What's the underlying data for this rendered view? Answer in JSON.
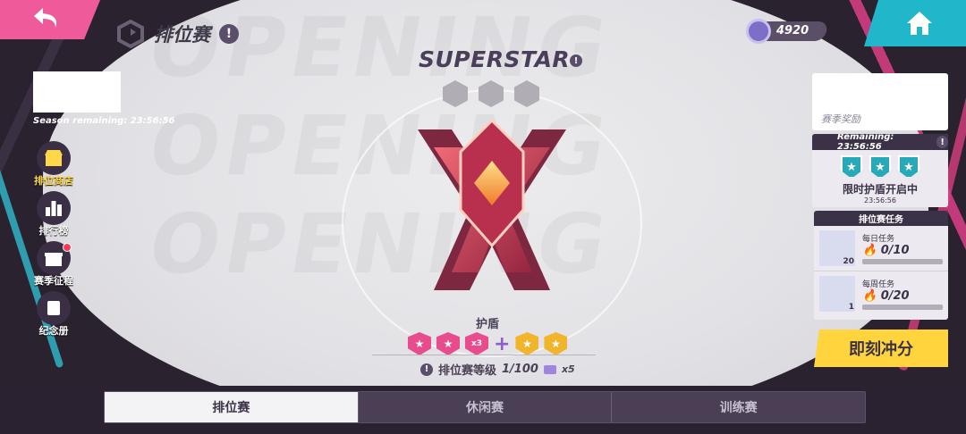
{
  "header": {
    "title": "排位赛",
    "currency_value": "4920"
  },
  "season": {
    "remaining": "Season remaining: 23:56:56"
  },
  "side_nav": {
    "items": [
      {
        "label": "排位商店"
      },
      {
        "label": "排行榜"
      },
      {
        "label": "赛季征程"
      },
      {
        "label": "纪念册"
      }
    ]
  },
  "rank": {
    "name": "SUPERSTAR",
    "shield_label": "护盾",
    "multiplier": "x3",
    "challenge_label": "排位赛等级",
    "challenge_progress": "1/100",
    "ticket_multiplier": "x5"
  },
  "reward": {
    "label": "赛季奖励"
  },
  "shield_panel": {
    "remaining": "Remaining: 23:56:56",
    "title": "限时护盾开启中",
    "time": "23:56:56"
  },
  "tasks": {
    "header": "排位赛任务",
    "items": [
      {
        "name": "每日任务",
        "progress": "0/10",
        "count": "20"
      },
      {
        "name": "每周任务",
        "progress": "0/20",
        "count": "1"
      }
    ]
  },
  "actions": {
    "go_label": "即刻冲分"
  },
  "tabs": [
    {
      "label": "排位赛"
    },
    {
      "label": "休闲赛"
    },
    {
      "label": "训练赛"
    }
  ],
  "colors": {
    "pink": "#ef5b9a",
    "teal": "#1fb7c9",
    "gold": "#ffd43c",
    "dark": "#2a2231"
  }
}
